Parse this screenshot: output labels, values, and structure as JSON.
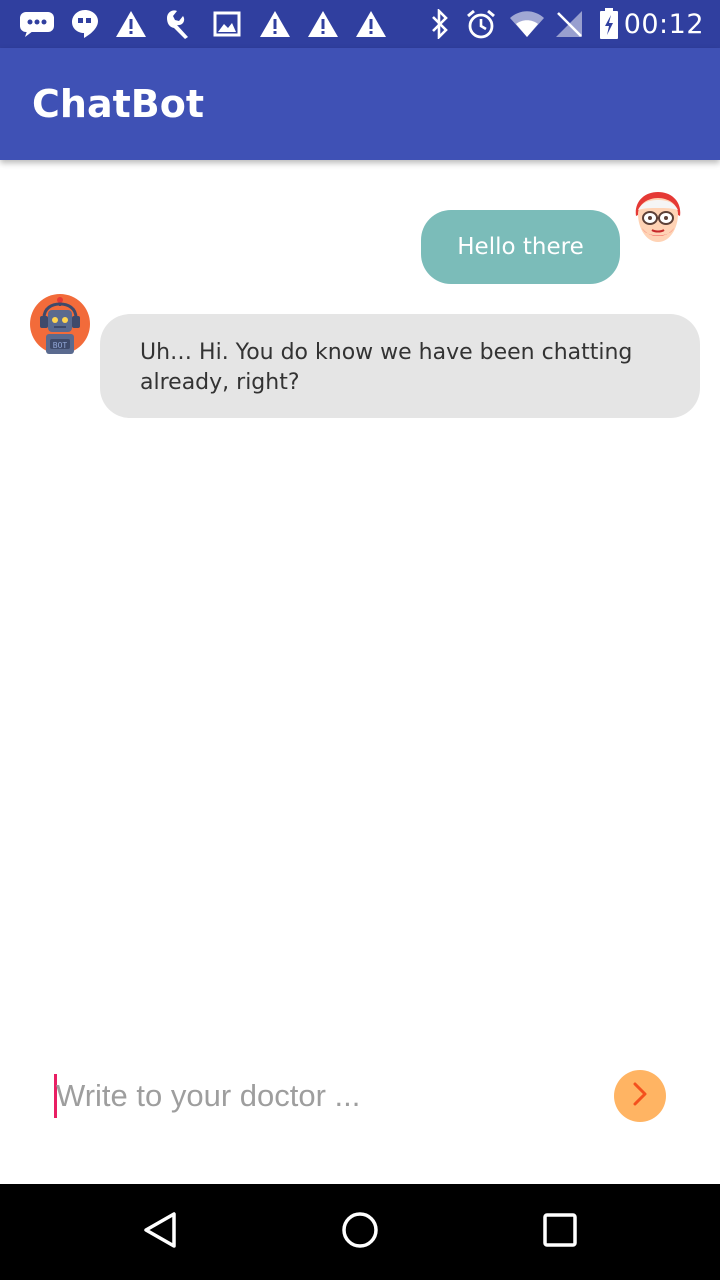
{
  "status_bar": {
    "time": "00:12",
    "icons": [
      "messages-icon",
      "hangouts-icon",
      "warning-icon",
      "wrench-icon",
      "image-icon",
      "warning-icon",
      "warning-icon",
      "warning-icon",
      "bluetooth-icon",
      "alarm-icon",
      "wifi-icon",
      "no-signal-icon",
      "battery-charging-icon"
    ]
  },
  "app_bar": {
    "title": "ChatBot",
    "color": "#3f51b5"
  },
  "messages": [
    {
      "sender": "user",
      "text": "Hello there",
      "bubble_color": "#7bbcb9",
      "avatar": "grandma-avatar-icon"
    },
    {
      "sender": "bot",
      "text": "Uh… Hi. You do know we have been chatting already, right?",
      "bubble_color": "#e5e5e5",
      "avatar": "robot-avatar-icon"
    }
  ],
  "input": {
    "placeholder": "Write to your doctor ...",
    "value": "",
    "send_button_icon": "chevron-right-icon",
    "send_button_color": "#ffb463"
  },
  "nav_bar": {
    "buttons": [
      "back-icon",
      "home-icon",
      "recents-icon"
    ]
  }
}
